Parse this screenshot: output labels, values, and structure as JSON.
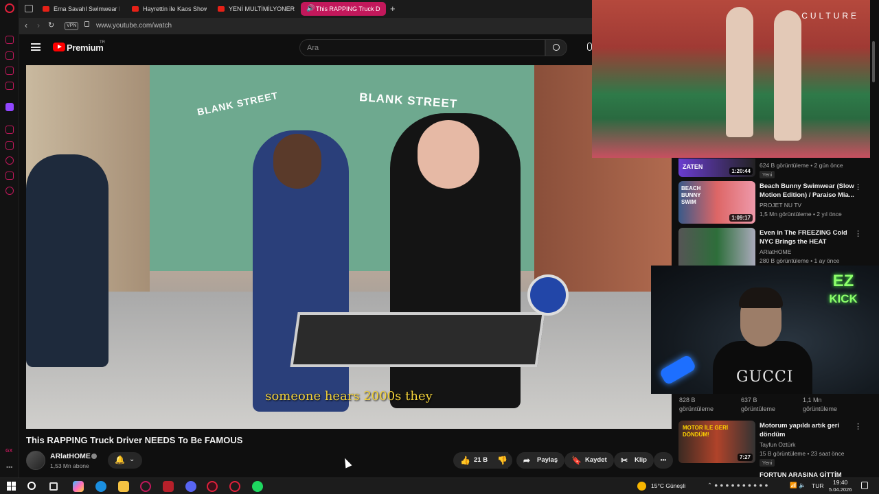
{
  "browser": {
    "tabs": [
      {
        "label": "Ema Savahl Swimwear Fa"
      },
      {
        "label": "Hayrettin ile Kaos Show -"
      },
      {
        "label": "YENİ MULTİMİLYONER AF"
      },
      {
        "label": "This RAPPING Truck D"
      }
    ],
    "new_tab": "+",
    "vpn_label": "VPN",
    "url": "www.youtube.com/watch"
  },
  "youtube": {
    "logo_text": "Premium",
    "logo_sup": "TR",
    "search_placeholder": "Ara"
  },
  "video": {
    "subtitle": "someone hears 2000s they",
    "sign_left": "BLANK STREET",
    "sign_right": "BLANK STREET",
    "title": "This RAPPING Truck Driver NEEDS To Be FAMOUS",
    "channel": "ARlatHOME",
    "subscribers": "1,53 Mn abone",
    "likes": "21 B",
    "share_label": "Paylaş",
    "save_label": "Kaydet",
    "clip_label": "Klip",
    "more_label": "•••"
  },
  "pip": {
    "brand": "CULTURE"
  },
  "recommendations": [
    {
      "title": "",
      "channel": "",
      "meta": "624 B görüntüleme • 2 gün önce",
      "duration": "1:20:44",
      "badge": "Yeni",
      "thumb_text": "ZATEN"
    },
    {
      "title": "Beach Bunny Swimwear (Slow Motion Edition) / Paraiso Mia...",
      "channel": "PROJET NU TV",
      "meta": "1,5 Mn görüntüleme • 2 yıl önce",
      "duration": "1:09:17",
      "badge": "",
      "thumb_text": "BEACH BUNNY SWIM"
    },
    {
      "title": "Even in The FREEZING Cold NYC Brings the HEAT",
      "channel": "ARlatHOME",
      "meta": "280 B görüntüleme • 1 ay önce",
      "duration": "",
      "badge": "",
      "thumb_text": ""
    },
    {
      "title": "Motorum yapıldı artık geri döndüm",
      "channel": "Tayfun Öztürk",
      "meta": "15 B görüntüleme • 23 saat önce",
      "duration": "7:27",
      "badge": "Yeni",
      "thumb_text": "MOTOR İLE GERİ DÖNDÜM!"
    }
  ],
  "under_cam_views": [
    {
      "count": "828 B",
      "label": "görüntüleme"
    },
    {
      "count": "637 B",
      "label": "görüntüleme"
    },
    {
      "count": "1,1 Mn",
      "label": "görüntüleme"
    }
  ],
  "partial_next_title": "FORTUN ARASINA GİTTİM",
  "webcam": {
    "neon_line1": "EZ",
    "neon_line2": "KICK",
    "shirt_text": "GUCCI"
  },
  "taskbar": {
    "weather": "15°C  Güneşli",
    "lang": "TUR",
    "time": "19:40",
    "date": "5.04.2026"
  },
  "colors": {
    "accent": "#c2185b",
    "youtube_red": "#ff0000",
    "subtitle_yellow": "#f3d23a",
    "neon_green": "#8dff6a"
  }
}
